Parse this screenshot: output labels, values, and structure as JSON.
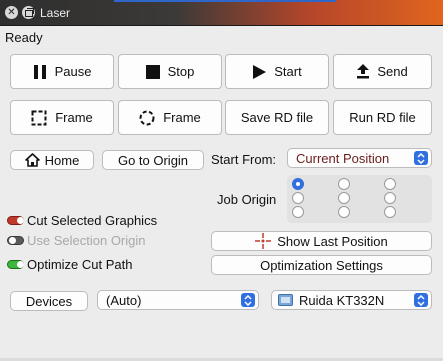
{
  "window": {
    "title": "Laser"
  },
  "status": "Ready",
  "row1": {
    "pause": "Pause",
    "stop": "Stop",
    "start": "Start",
    "send": "Send"
  },
  "row2": {
    "frame_rect": "Frame",
    "frame_circle": "Frame",
    "save_rd": "Save RD file",
    "run_rd": "Run RD file"
  },
  "nav": {
    "home": "Home",
    "go_to_origin": "Go to Origin"
  },
  "start_from": {
    "label": "Start From:",
    "value": "Current Position"
  },
  "job_origin": {
    "label": "Job Origin",
    "selected": "top-left"
  },
  "options": {
    "cut_selected": {
      "label": "Cut Selected Graphics",
      "checked": true
    },
    "use_selection_origin": {
      "label": "Use Selection Origin",
      "checked": false,
      "enabled": false
    },
    "optimize_cut_path": {
      "label": "Optimize Cut Path",
      "checked": true
    }
  },
  "actions": {
    "show_last_position": "Show Last Position",
    "optimization_settings": "Optimization Settings"
  },
  "devices": {
    "button": "Devices",
    "port_value": "(Auto)",
    "device_value": "Ruida KT332N"
  },
  "colors": {
    "accent": "#2f6fe0",
    "start_from_text": "#6b1d1d"
  }
}
